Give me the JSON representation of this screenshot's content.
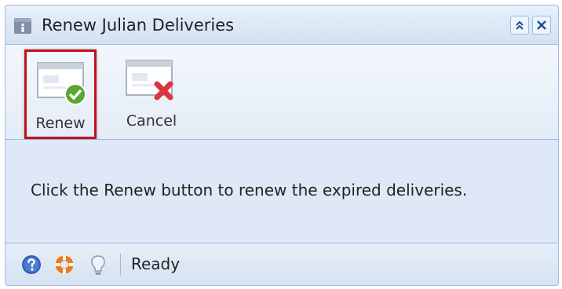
{
  "window": {
    "title": "Renew Julian Deliveries",
    "title_icon": "info-window-icon",
    "controls": [
      {
        "name": "collapse",
        "icon": "double-chevron-up-icon"
      },
      {
        "name": "close",
        "icon": "close-icon"
      }
    ]
  },
  "toolbar": {
    "renew_label": "Renew",
    "cancel_label": "Cancel"
  },
  "content": {
    "message": "Click the Renew button to renew the expired deliveries."
  },
  "statusbar": {
    "icons": [
      "help-icon",
      "support-lifebuoy-icon",
      "lightbulb-icon"
    ],
    "status": "Ready"
  },
  "colors": {
    "highlight": "#c0111a",
    "border": "#99bbe8",
    "panel": "#dfe8f6",
    "check_green": "#5aa82e",
    "cancel_red": "#d9363e"
  }
}
